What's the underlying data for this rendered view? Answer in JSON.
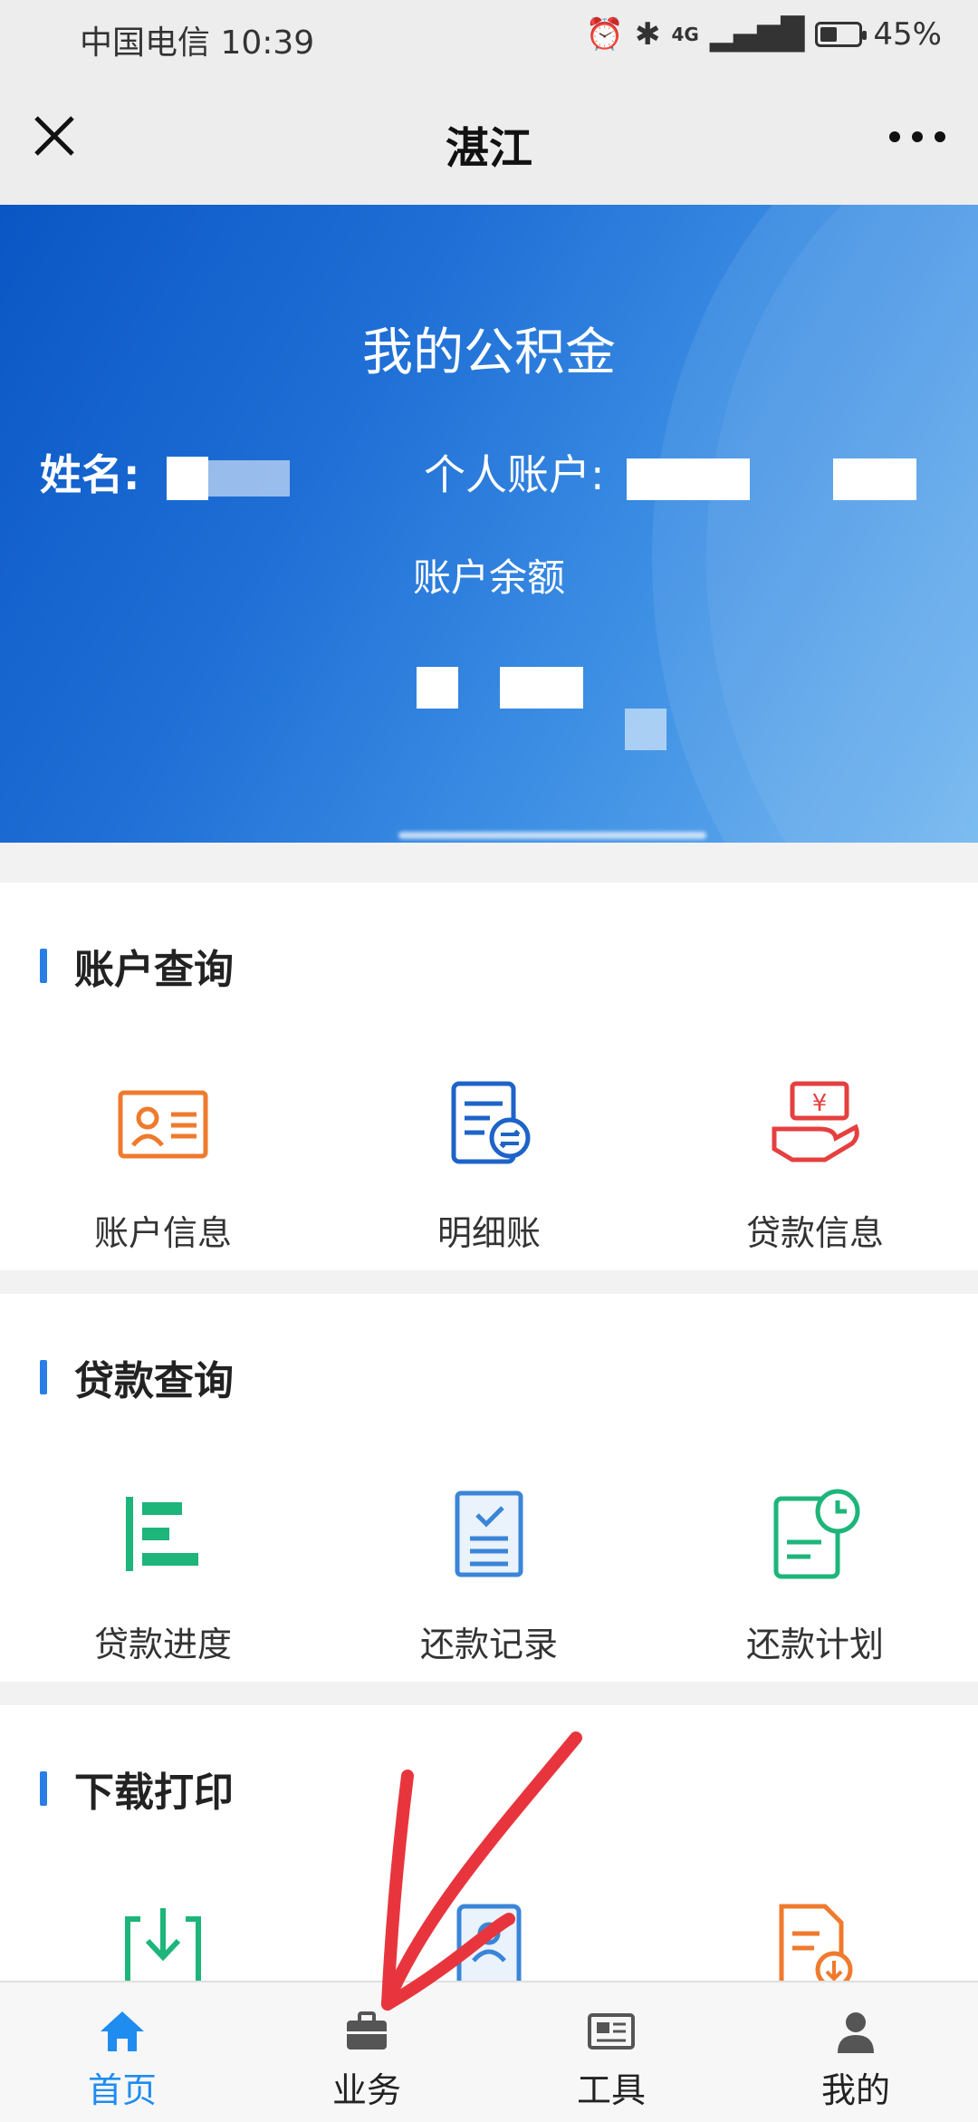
{
  "status_bar": {
    "carrier_time": "中国电信 10:39",
    "network": "4G",
    "battery": "45%",
    "battery_level": 0.45
  },
  "nav": {
    "title": "湛江"
  },
  "banner": {
    "title": "我的公积金",
    "name_label": "姓名:",
    "account_label": "个人账户:",
    "balance_label": "账户余额"
  },
  "sections": [
    {
      "title": "账户查询",
      "items": [
        {
          "label": "账户信息",
          "icon": "id-card-icon"
        },
        {
          "label": "明细账",
          "icon": "ledger-icon"
        },
        {
          "label": "贷款信息",
          "icon": "loan-hand-icon"
        }
      ]
    },
    {
      "title": "贷款查询",
      "items": [
        {
          "label": "贷款进度",
          "icon": "progress-bars-icon"
        },
        {
          "label": "还款记录",
          "icon": "checklist-icon"
        },
        {
          "label": "还款计划",
          "icon": "clock-document-icon"
        }
      ]
    },
    {
      "title": "下载打印",
      "items": [
        {
          "label": "",
          "icon": "download-icon"
        },
        {
          "label": "",
          "icon": "person-document-icon"
        },
        {
          "label": "",
          "icon": "document-download-icon"
        }
      ]
    }
  ],
  "tabbar": {
    "tabs": [
      {
        "label": "首页",
        "icon": "home-icon",
        "active": true
      },
      {
        "label": "业务",
        "icon": "briefcase-icon"
      },
      {
        "label": "工具",
        "icon": "newspaper-icon"
      },
      {
        "label": "我的",
        "icon": "user-icon"
      }
    ]
  },
  "colors": {
    "accent": "#1f8cf0",
    "banner_start": "#0a56c4",
    "banner_end": "#69b2ef",
    "orange": "#ef7a2d",
    "green": "#1db57a",
    "red": "#e5403f",
    "annotation": "#e8353d"
  }
}
